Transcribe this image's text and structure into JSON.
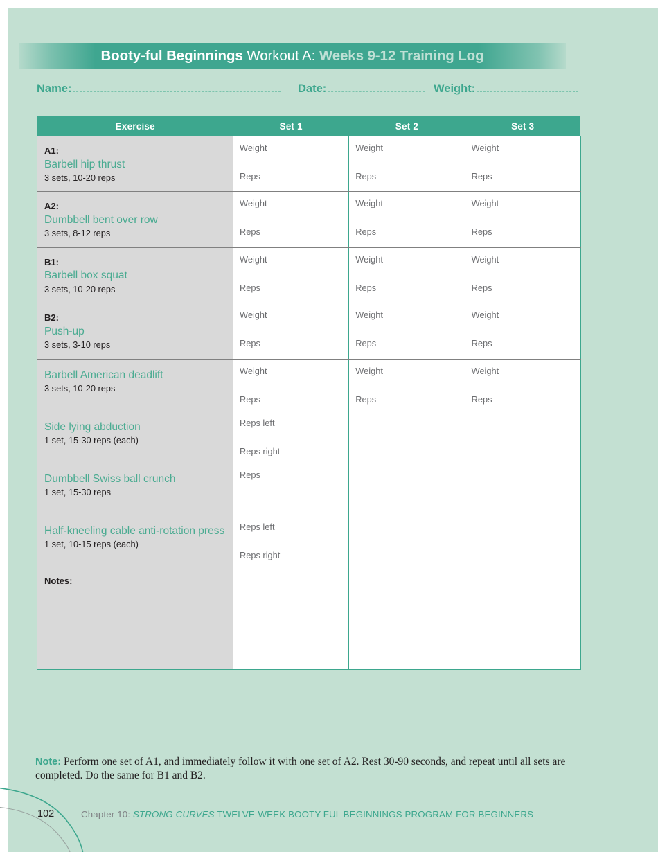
{
  "colors": {
    "page_bg": "#c3e0d2",
    "teal": "#3da78e",
    "teal_light": "#4aab91",
    "header_soft": "#bfe0d5",
    "cell_gray": "#d9d9d9",
    "label_gray": "#6d6e71",
    "footer_gray": "#808285"
  },
  "header": {
    "title_strong": "Booty-ful Beginnings",
    "title_mid": "Workout A:",
    "title_soft": "Weeks 9-12 Training Log"
  },
  "meta": {
    "name_label": "Name:",
    "date_label": "Date:",
    "weight_label": "Weight:"
  },
  "table": {
    "columns": [
      "Exercise",
      "Set 1",
      "Set 2",
      "Set 3"
    ],
    "rows": [
      {
        "tag": "A1:",
        "name": "Barbell hip thrust",
        "sets": "3 sets, 10-20 reps",
        "fields": [
          "Weight",
          "Reps"
        ],
        "set_count": 3
      },
      {
        "tag": "A2:",
        "name": "Dumbbell bent over row",
        "sets": "3 sets, 8-12 reps",
        "fields": [
          "Weight",
          "Reps"
        ],
        "set_count": 3
      },
      {
        "tag": "B1:",
        "name": "Barbell box squat",
        "sets": "3 sets, 10-20 reps",
        "fields": [
          "Weight",
          "Reps"
        ],
        "set_count": 3
      },
      {
        "tag": "B2:",
        "name": "Push-up",
        "sets": "3 sets, 3-10 reps",
        "fields": [
          "Weight",
          "Reps"
        ],
        "set_count": 3
      },
      {
        "tag": "",
        "name": "Barbell American deadlift",
        "sets": "3 sets, 10-20 reps",
        "fields": [
          "Weight",
          "Reps"
        ],
        "set_count": 3
      },
      {
        "tag": "",
        "name": "Side lying abduction",
        "sets": "1 set, 15-30 reps (each)",
        "fields": [
          "Reps left",
          "Reps right"
        ],
        "set_count": 1
      },
      {
        "tag": "",
        "name": "Dumbbell Swiss ball crunch",
        "sets": "1 set, 15-30 reps",
        "fields": [
          "Reps"
        ],
        "set_count": 1
      },
      {
        "tag": "",
        "name": "Half-kneeling cable anti-rotation press",
        "sets": "1 set, 10-15 reps (each)",
        "fields": [
          "Reps left",
          "Reps right"
        ],
        "set_count": 1
      }
    ],
    "notes_label": "Notes:"
  },
  "note": {
    "key": "Note:",
    "body": " Perform one set of A1, and immediately follow it with one set of A2. Rest 30-90 seconds, and repeat until all sets are completed. Do the same for B1 and B2."
  },
  "footer": {
    "page_number": "102",
    "chapter": "Chapter 10:",
    "book_title": "STRONG CURVES",
    "program": "TWELVE-WEEK BOOTY-FUL BEGINNINGS PROGRAM FOR BEGINNERS"
  }
}
